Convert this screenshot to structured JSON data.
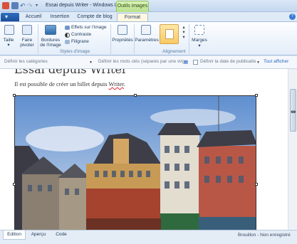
{
  "window": {
    "title": "Essai depuis Writer - Windows Liv...",
    "context_tab_group": "Outils images"
  },
  "quick_access": [
    "app-menu-icon",
    "save-icon",
    "undo-icon",
    "redo-icon",
    "dropdown-icon"
  ],
  "tabs": {
    "file_label": "▾",
    "items": [
      {
        "label": "Accueil",
        "active": false
      },
      {
        "label": "Insertion",
        "active": false
      },
      {
        "label": "Compte de blog",
        "active": false
      },
      {
        "label": "Format",
        "active": true
      }
    ]
  },
  "ribbon": {
    "taille": "Taille",
    "faire_pivoter": "Faire pivoter",
    "bordures": "Bordures de l'image",
    "effets": "Effets sur l'image",
    "contraste": "Contraste",
    "filigrane": "Filigrane",
    "styles_label": "Styles d'image",
    "proprietes": "Propriétés",
    "parametres": "Paramètres",
    "alignement_label": "Alignement",
    "marges": "Marges"
  },
  "propbar": {
    "categories_placeholder": "Définir les catégories",
    "tags_placeholder": "Définir les mots clés (séparés par une virg",
    "date_label": "Définir la date de publicatio",
    "show_all": "Tout afficher"
  },
  "post": {
    "title": "Essai depuis Writer",
    "body_prefix": "Il est possible de créer un billet depuis ",
    "body_word": "Writer",
    "body_suffix": "."
  },
  "bottom": {
    "tabs": [
      {
        "label": "Edition",
        "active": true
      },
      {
        "label": "Aperçu",
        "active": false
      },
      {
        "label": "Code",
        "active": false
      }
    ],
    "status": "Brouillon - Non enregistré"
  },
  "colors": {
    "accent": "#2e6fc0",
    "context_green": "#b8e08a",
    "selected_align": "#f8c964"
  }
}
